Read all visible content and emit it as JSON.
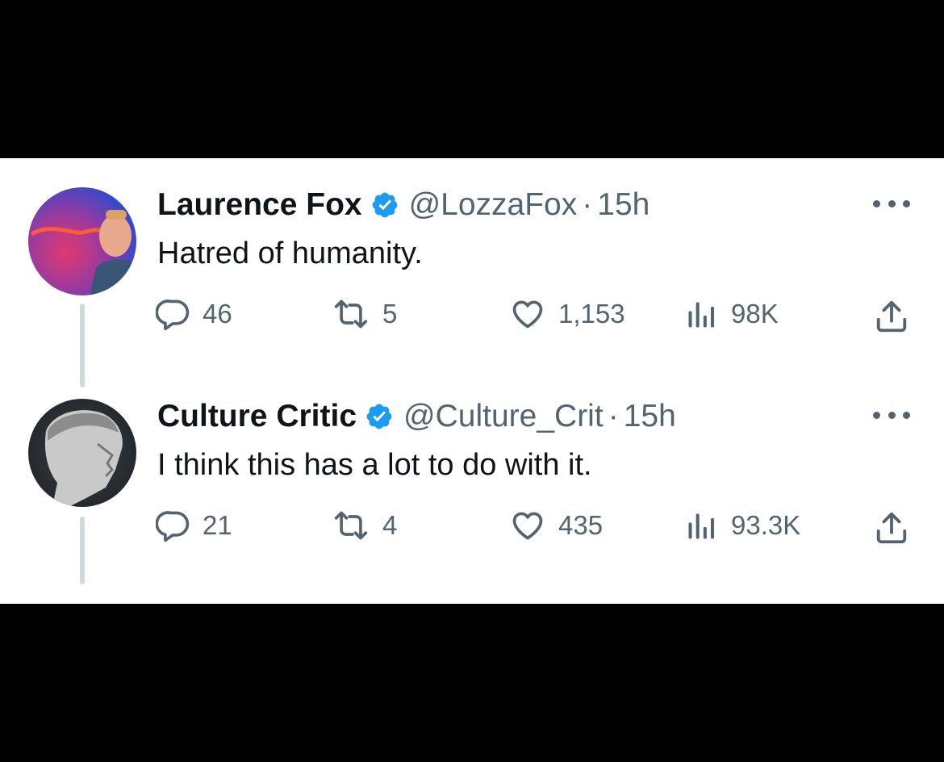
{
  "colors": {
    "background": "#000000",
    "card": "#ffffff",
    "text": "#0f1419",
    "secondary": "#536471",
    "verified": "#1d9bf0",
    "thread_line": "#cfd9de"
  },
  "icons": {
    "reply": "reply-icon",
    "retweet": "retweet-icon",
    "like": "heart-icon",
    "views": "views-chart-icon",
    "share": "share-icon",
    "more": "more-dots-icon",
    "verified": "verified-badge-icon"
  },
  "tweets": [
    {
      "name": "Laurence Fox",
      "handle": "@LozzaFox",
      "separator": "·",
      "time": "15h",
      "text": "Hatred of humanity.",
      "replies": "46",
      "retweets": "5",
      "likes": "1,153",
      "views": "98K"
    },
    {
      "name": "Culture Critic",
      "handle": "@Culture_Crit",
      "separator": "·",
      "time": "15h",
      "text": "I think this has a lot to do with it.",
      "replies": "21",
      "retweets": "4",
      "likes": "435",
      "views": "93.3K"
    }
  ]
}
